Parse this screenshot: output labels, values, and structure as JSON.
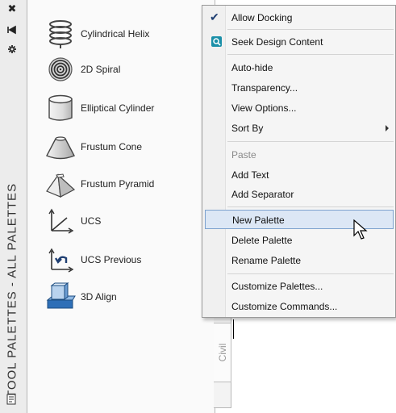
{
  "palette": {
    "title": "TOOL PALETTES - ALL PALETTES",
    "tools": [
      {
        "label": "Cylindrical Helix",
        "icon": "helix-icon"
      },
      {
        "label": "2D Spiral",
        "icon": "spiral-icon"
      },
      {
        "label": "Elliptical Cylinder",
        "icon": "elliptical-cylinder-icon"
      },
      {
        "label": "Frustum Cone",
        "icon": "frustum-cone-icon"
      },
      {
        "label": "Frustum Pyramid",
        "icon": "frustum-pyramid-icon"
      },
      {
        "label": "UCS",
        "icon": "ucs-icon"
      },
      {
        "label": "UCS Previous",
        "icon": "ucs-previous-icon"
      },
      {
        "label": "3D Align",
        "icon": "3d-align-icon"
      }
    ],
    "tabs": [
      {
        "label": "Civil"
      }
    ]
  },
  "context_menu": {
    "items": [
      {
        "label": "Allow Docking",
        "checked": true
      },
      {
        "label": "Seek Design Content",
        "icon": "seek-icon"
      },
      {
        "label": "Auto-hide"
      },
      {
        "label": "Transparency..."
      },
      {
        "label": "View Options..."
      },
      {
        "label": "Sort By",
        "submenu": true
      },
      {
        "label": "Paste",
        "disabled": true
      },
      {
        "label": "Add Text"
      },
      {
        "label": "Add Separator"
      },
      {
        "label": "New Palette",
        "highlighted": true
      },
      {
        "label": "Delete Palette"
      },
      {
        "label": "Rename Palette"
      },
      {
        "label": "Customize Palettes..."
      },
      {
        "label": "Customize Commands..."
      }
    ]
  },
  "colors": {
    "highlight_bg": "#dce7f5",
    "highlight_border": "#7da2ce",
    "check": "#1f3f72",
    "seek_icon": "#1a8fa8"
  }
}
